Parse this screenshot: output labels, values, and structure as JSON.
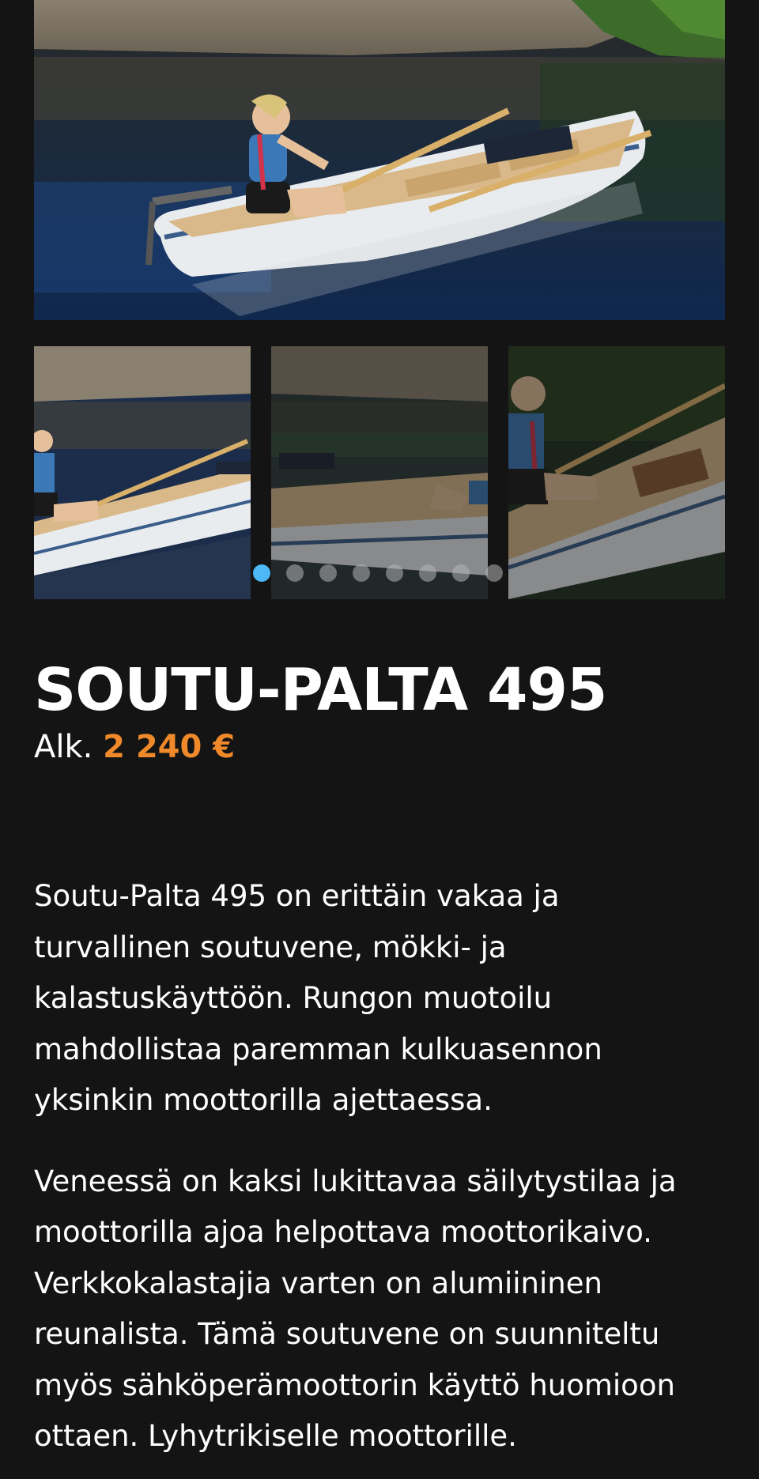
{
  "gallery": {
    "main_image": "boat-photo",
    "thumbnails": [
      "boat-photo-wide",
      "boat-photo-motion",
      "boat-photo-closeup"
    ],
    "dot_count": 8,
    "active_dot": 0
  },
  "product": {
    "title": "SOUTU-PALTA 495",
    "price_prefix": "Alk.",
    "price": "2 240 €"
  },
  "description": {
    "paragraphs": [
      "Soutu-Palta 495 on erittäin vakaa ja turvallinen soutuvene, mökki- ja kalastuskäyttöön. Rungon muotoilu mahdollistaa paremman kulkuasennon yksinkin moottorilla ajettaessa.",
      "Veneessä on kaksi lukittavaa säilytystilaa ja moottorilla ajoa helpottava moottorikaivo. Verkkokalastajia varten on alumiininen reunalista. Tämä soutuvene on suunniteltu myös sähköperämoottorin käyttö huomioon ottaen. Lyhytrikiselle moottorille."
    ]
  },
  "colors": {
    "background": "#141414",
    "accent_price": "#f0892a",
    "active_dot": "#4cb8f5"
  }
}
